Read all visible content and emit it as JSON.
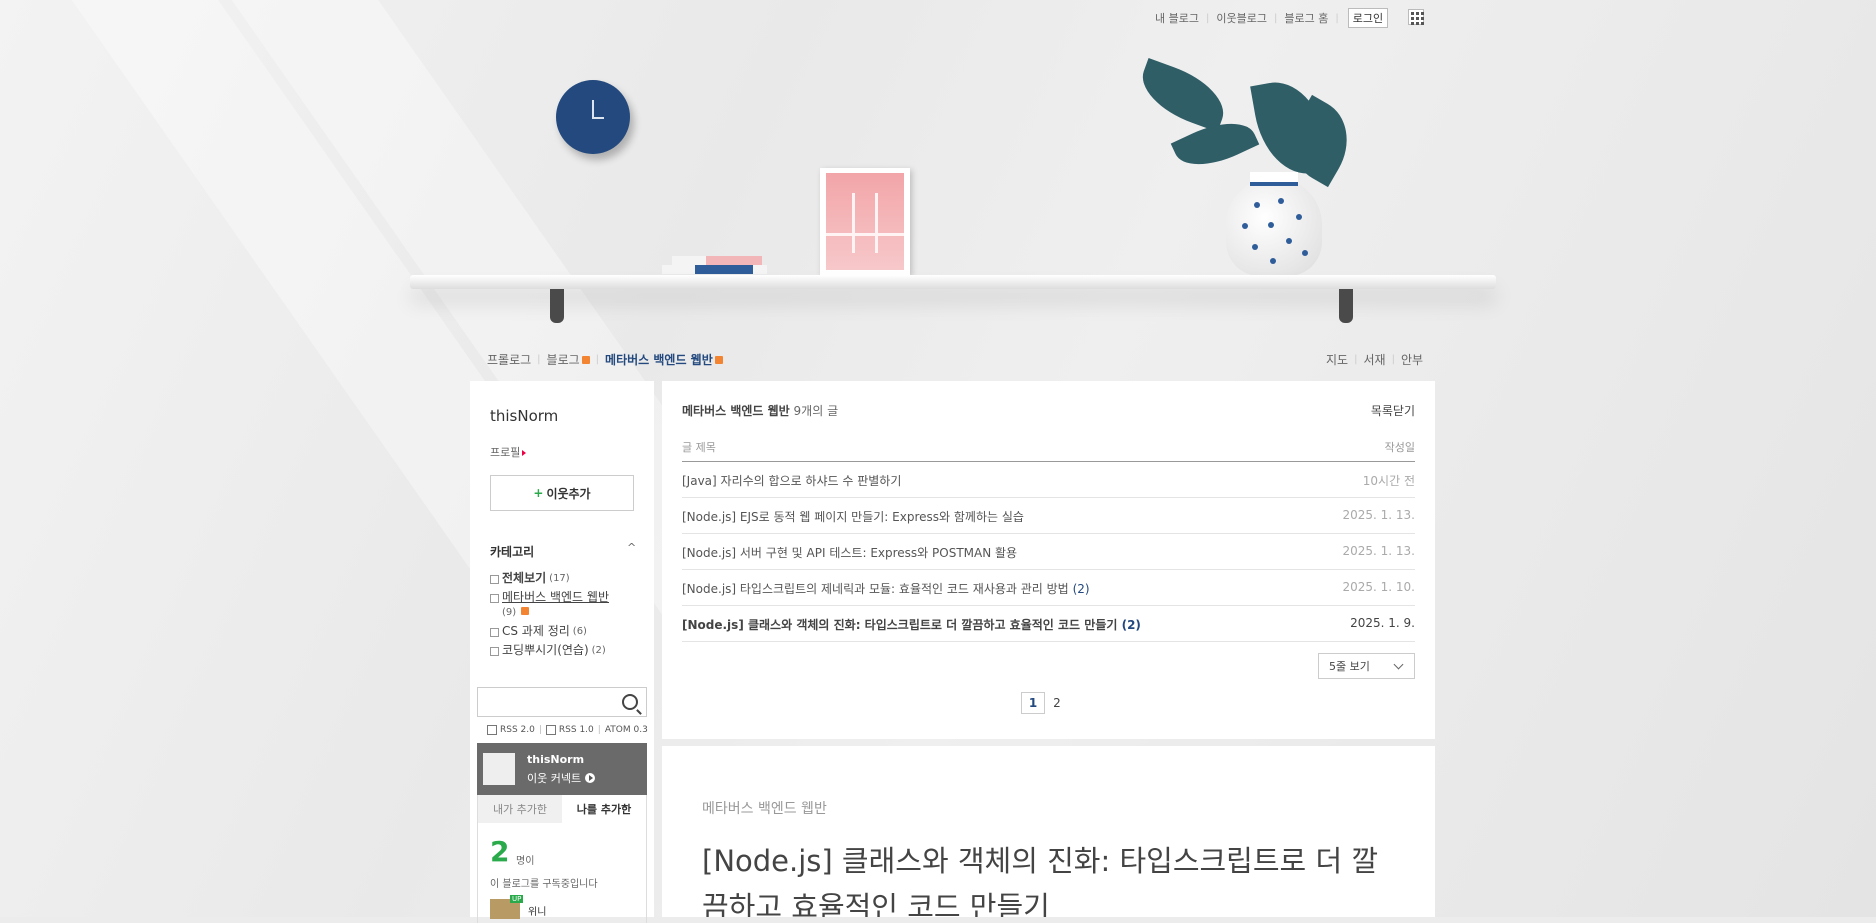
{
  "topbar": {
    "links": [
      "내 블로그",
      "이웃블로그",
      "블로그 홈"
    ],
    "login": "로그인"
  },
  "nav": {
    "left": [
      {
        "label": "프롤로그"
      },
      {
        "label": "블로그",
        "rss": true
      },
      {
        "label": "메타버스 백엔드 웹반",
        "rss": true,
        "active": true
      }
    ],
    "right": [
      "지도",
      "서재",
      "안부"
    ]
  },
  "sidebar": {
    "blog_name": "thisNorm",
    "profile": "프로필",
    "add_neighbor": "이웃추가",
    "category_title": "카테고리",
    "categories": [
      {
        "name": "전체보기",
        "count": "(17)"
      },
      {
        "name": "메타버스 백엔드 웹반",
        "count": "(9)"
      },
      {
        "name": "CS 과제 정리",
        "count": "(6)"
      },
      {
        "name": "코딩뿌시기(연습)",
        "count": "(2)"
      }
    ],
    "feeds": [
      "RSS 2.0",
      "RSS 1.0",
      "ATOM 0.3"
    ],
    "widget": {
      "name": "thisNorm",
      "sub": "이웃 커넥트",
      "tab_off": "내가 추가한",
      "tab_on": "나를 추가한",
      "count": "2",
      "unit": "명이",
      "desc": "이 블로그를 구독중입니다",
      "neighbor_name": "위니",
      "up_badge": "UP"
    }
  },
  "post_list": {
    "category": "메타버스 백엔드 웹반",
    "count_text": "9개의 글",
    "close": "목록닫기",
    "col_title": "글 제목",
    "col_date": "작성일",
    "rows": [
      {
        "title": "[Java] 자리수의 합으로 하샤드 수 판별하기",
        "comments": "",
        "date": "10시간 전"
      },
      {
        "title": "[Node.js] EJS로 동적 웹 페이지 만들기: Express와 함께하는 실습",
        "comments": "",
        "date": "2025. 1. 13."
      },
      {
        "title": "[Node.js] 서버 구현 및 API 테스트: Express와 POSTMAN 활용",
        "comments": "",
        "date": "2025. 1. 13."
      },
      {
        "title": "[Node.js] 타입스크립트의 제네릭과 모듈: 효율적인 코드 재사용과 관리 방법",
        "comments": "(2)",
        "date": "2025. 1. 10."
      },
      {
        "title": "[Node.js] 클래스와 객체의 진화: 타입스크립트로 더 깔끔하고 효율적인 코드 만들기",
        "comments": "(2)",
        "date": "2025. 1. 9."
      }
    ],
    "per_page": "5줄 보기",
    "pages": [
      "1",
      "2"
    ]
  },
  "post": {
    "category": "메타버스 백엔드 웹반",
    "title": "[Node.js] 클래스와 객체의 진화: 타입스크립트로 더 깔끔하고 효율적인 코드 만들기"
  },
  "colors": {
    "accent": "#23497e",
    "add_green": "#2aaa4b",
    "rss_orange": "#f28432",
    "background": "#ececec"
  }
}
